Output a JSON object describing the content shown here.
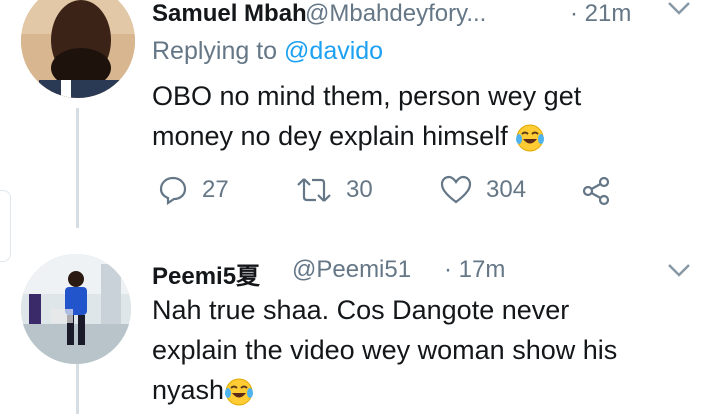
{
  "tweet1": {
    "name": "Samuel Mbah",
    "handle": "@Mbahdeyfory...",
    "time": "· 21m",
    "replying_prefix": "Replying to ",
    "replying_to": "@davido",
    "text_line1": "OBO no mind them, person wey get",
    "text_line2": "money no dey explain himself",
    "emoji": "face-with-tears-of-joy",
    "replies": "27",
    "retweets": "30",
    "likes": "304"
  },
  "tweet2": {
    "name": "Peemi5夏",
    "handle": "@Peemi51",
    "time": "· 17m",
    "text_line1": "Nah true shaa. Cos Dangote never",
    "text_line2": "explain the video wey woman show his",
    "text_line3": "nyash",
    "emoji": "face-with-tears-of-joy"
  },
  "colors": {
    "name": "#14171a",
    "muted": "#657786",
    "link": "#1da1f2",
    "thread_line": "#d6dee3"
  }
}
